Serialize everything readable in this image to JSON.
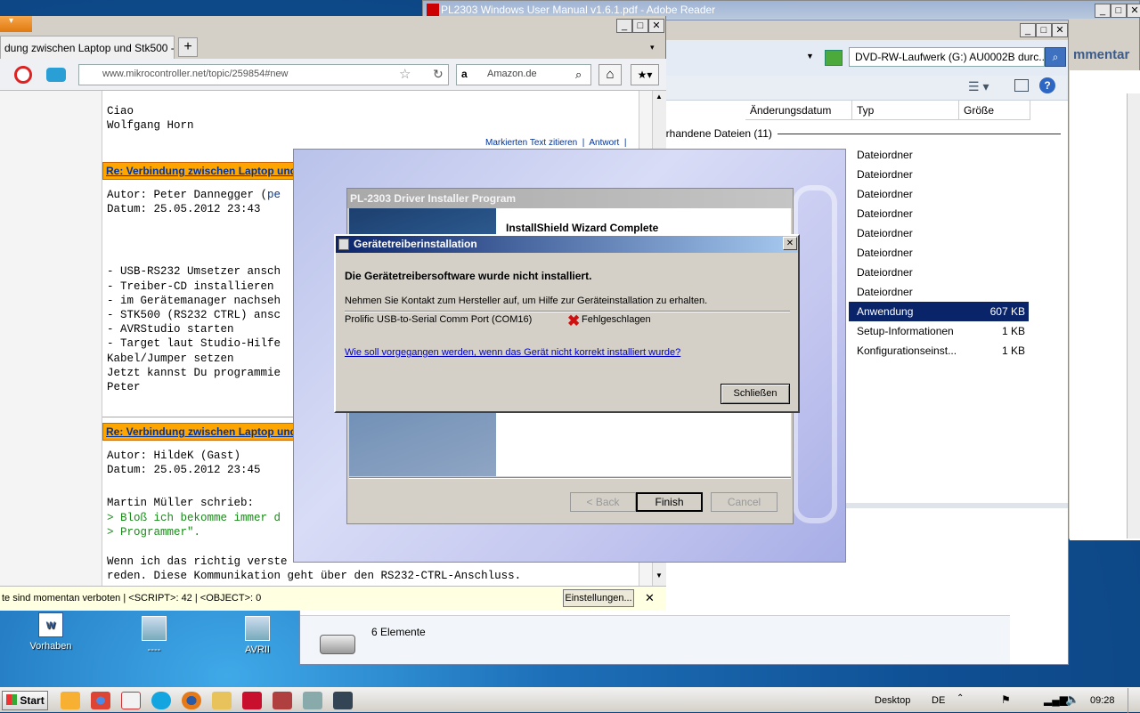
{
  "pdf_window": {
    "title": "PL2303 Windows User Manual v1.6.1.pdf - Adobe Reader",
    "side_text": "mmentar"
  },
  "explorer": {
    "address": "DVD-RW-Laufwerk (G:) AU0002B durc...",
    "columns": [
      "Änderungsdatum",
      "Typ",
      "Größe"
    ],
    "group": "orhandene Dateien (11)",
    "rows": [
      {
        "type": "Dateiordner",
        "size": ""
      },
      {
        "type": "Dateiordner",
        "size": ""
      },
      {
        "type": "Dateiordner",
        "size": ""
      },
      {
        "type": "Dateiordner",
        "size": ""
      },
      {
        "type": "Dateiordner",
        "size": ""
      },
      {
        "type": "Dateiordner",
        "size": ""
      },
      {
        "type": "Dateiordner",
        "size": ""
      },
      {
        "type": "Dateiordner",
        "size": ""
      },
      {
        "type": "Anwendung",
        "size": "607 KB"
      },
      {
        "type": "Setup-Informationen",
        "size": "1 KB"
      },
      {
        "type": "Konfigurationseinst...",
        "size": "1 KB"
      }
    ],
    "status": "6 Elemente"
  },
  "browser": {
    "tab": "dung zwischen Laptop und Stk500 - Mi...",
    "url": "www.mikrocontroller.net/topic/259854#new",
    "search_placeholder": "Amazon.de",
    "post0_lines": [
      "Ciao",
      "Wolfgang Horn"
    ],
    "quote_link": "Markierten Text zitieren",
    "answer_link": "Antwort",
    "post1_header": "Re: Verbindung zwischen Laptop und",
    "post1_author": "Autor: Peter Dannegger (",
    "post1_author_link": "pe",
    "post1_date": "Datum: 25.05.2012 23:43",
    "post1_lines": [
      "- USB-RS232 Umsetzer ansch",
      "- Treiber-CD installieren",
      "- im Gerätemanager nachseh",
      "- STK500 (RS232 CTRL) ansc",
      "- AVRStudio starten",
      "- Target laut Studio-Hilfe",
      "Kabel/Jumper setzen",
      "Jetzt kannst Du programmie",
      "",
      "",
      "Peter"
    ],
    "post2_header": "Re: Verbindung zwischen Laptop und",
    "post2_author": "Autor: HildeK (Gast)",
    "post2_date": "Datum: 25.05.2012 23:45",
    "post2_lines": [
      "Martin Müller schrieb:"
    ],
    "post2_quotes": [
      "> Bloß ich bekomme immer d",
      "> Programmer\"."
    ],
    "post2_tail": [
      "Wenn ich das richtig verste",
      "reden. Diese Kommunikation geht über den RS232-CTRL-Anschluss."
    ],
    "statusbar": "te sind momentan verboten | <SCRIPT>: 42 | <OBJECT>: 0",
    "settings_button": "Einstellungen..."
  },
  "installer": {
    "title": "PL-2303 Driver Installer Program",
    "heading": "InstallShield Wizard Complete",
    "back": "< Back",
    "finish": "Finish",
    "cancel": "Cancel"
  },
  "dialog": {
    "title": "Gerätetreiberinstallation",
    "heading": "Die Gerätetreibersoftware wurde nicht installiert.",
    "info": "Nehmen Sie Kontakt zum Hersteller auf, um Hilfe zur Geräteinstallation zu erhalten.",
    "device": "Prolific USB-to-Serial Comm Port (COM16)",
    "status": "Fehlgeschlagen",
    "link": "Wie soll vorgegangen werden, wenn das Gerät nicht korrekt installiert wurde?",
    "close": "Schließen"
  },
  "desktop": {
    "icons": [
      "Vorhaben",
      "----",
      "AVRII"
    ]
  },
  "taskbar": {
    "start": "Start",
    "desktop": "Desktop",
    "lang": "DE",
    "time": "09:28"
  }
}
